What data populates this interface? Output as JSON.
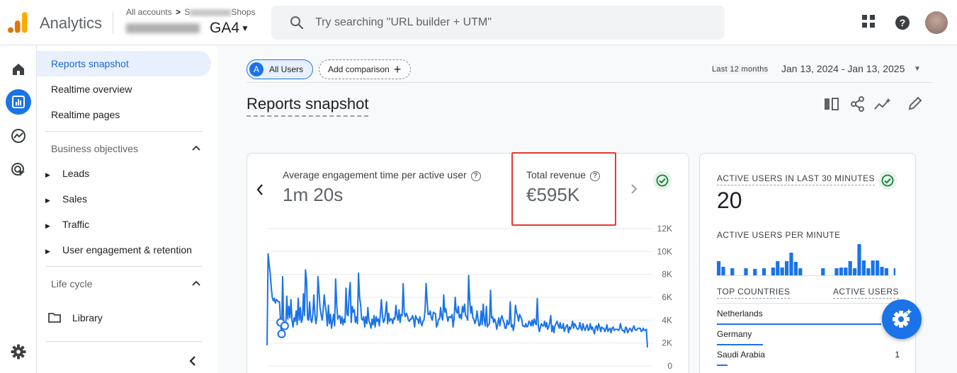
{
  "header": {
    "app_name": "Analytics",
    "breadcrumb_prefix": "All accounts",
    "breadcrumb_separator": ">",
    "breadcrumb_account_partial": "S",
    "breadcrumb_account_suffix": "Shops",
    "property_suffix": "GA4",
    "search_placeholder": "Try searching \"URL builder + UTM\""
  },
  "icons": {
    "apps": "apps-grid-icon",
    "help": "help-circle-icon",
    "home": "home-icon",
    "reports": "reports-icon",
    "explore": "explore-icon",
    "advertising": "advertising-icon",
    "settings": "settings-gear-icon"
  },
  "colors": {
    "accent": "#1a73e8",
    "highlight": "#e53935",
    "success": "#188038"
  },
  "sidenav": {
    "top_items": [
      {
        "label": "Reports snapshot",
        "active": true
      },
      {
        "label": "Realtime overview",
        "active": false
      },
      {
        "label": "Realtime pages",
        "active": false
      }
    ],
    "business_objectives": {
      "title": "Business objectives",
      "items": [
        "Leads",
        "Sales",
        "Traffic",
        "User engagement & retention"
      ]
    },
    "life_cycle": {
      "title": "Life cycle"
    },
    "library": "Library"
  },
  "toolbar": {
    "segment_badge": "A",
    "segment_label": "All Users",
    "add_comparison": "Add comparison",
    "date_preset": "Last 12 months",
    "date_range": "Jan 13, 2024 - Jan 13, 2025"
  },
  "page": {
    "title": "Reports snapshot"
  },
  "metrics": {
    "engagement": {
      "label": "Average engagement time per active user",
      "value": "1m 20s"
    },
    "revenue": {
      "label": "Total revenue",
      "value": "€595K"
    }
  },
  "chart_data": {
    "type": "line",
    "title": "",
    "xlabel": "",
    "ylabel": "",
    "ylim": [
      0,
      12000
    ],
    "y_ticks": [
      "12K",
      "10K",
      "8K",
      "6K",
      "4K",
      "2K",
      "0"
    ],
    "y_tick_values": [
      12000,
      10000,
      8000,
      6000,
      4000,
      2000,
      0
    ],
    "grid": true,
    "series": [
      {
        "values": [
          1800,
          9800,
          8900,
          8100,
          6900,
          6000,
          5700,
          5900,
          5500,
          5800,
          5700,
          5600,
          5600,
          3800,
          2800,
          7800,
          3500,
          3500,
          3600,
          6100,
          4100,
          5200,
          4200,
          5800,
          4000,
          3400,
          4200,
          3900,
          4800,
          3600,
          5900,
          4000,
          5100,
          3800,
          4100,
          6300,
          4400,
          8400,
          7400,
          4100,
          4000,
          5600,
          4100,
          3800,
          4500,
          6200,
          4500,
          3700,
          4300,
          7800,
          6400,
          5100,
          4500,
          4000,
          4900,
          6200,
          5300,
          4600,
          3500,
          5300,
          3700,
          4500,
          3300,
          3900,
          4500,
          3500,
          7600,
          5400,
          4100,
          4300,
          4400,
          3700,
          4300,
          3600,
          4100,
          3800,
          6800,
          4500,
          4400,
          6300,
          7300,
          3800,
          5200,
          4700,
          4900,
          3800,
          4300,
          3700,
          8100,
          6000,
          5400,
          4100,
          4000,
          4300,
          3400,
          4300,
          3700,
          5100,
          3900,
          3700,
          3300,
          4100,
          3600,
          4400,
          3400,
          4300,
          3900,
          4100,
          3500,
          4500,
          5800,
          4400,
          3800,
          4000,
          4700,
          5600,
          3700,
          4600,
          3900,
          4100,
          4100,
          3700,
          4200,
          4100,
          5300,
          4400,
          4000,
          4900,
          3800,
          4500,
          4400,
          7200,
          4600,
          4300,
          4600,
          4400,
          4000,
          3900,
          4100,
          4100,
          4400,
          4100,
          3400,
          4400,
          4100,
          4100,
          3700,
          4300,
          3800,
          3500,
          3900,
          4000,
          4800,
          7200,
          5600,
          4500,
          4500,
          4800,
          4200,
          4000,
          4700,
          4600,
          4600,
          3400,
          3600,
          4100,
          4100,
          5100,
          4300,
          4000,
          6200,
          4700,
          5000,
          4400,
          3900,
          4300,
          4300,
          4200,
          4500,
          3400,
          4200,
          6000,
          4800,
          4600,
          5200,
          4200,
          4500,
          4100,
          5200,
          4700,
          5400,
          4400,
          4300,
          4000,
          7900,
          5700,
          4600,
          5200,
          4200,
          4100,
          3700,
          4000,
          4800,
          4100,
          3500,
          3600,
          4800,
          3600,
          5400,
          4000,
          3500,
          5200,
          3400,
          3600,
          3700,
          6600,
          4200,
          4300,
          3800,
          4100,
          3800,
          3200,
          3700,
          4200,
          3500,
          4100,
          4400,
          4000,
          3800,
          3300,
          3300,
          4000,
          3600,
          3700,
          5600,
          3400,
          3600,
          3100,
          3700,
          5300,
          4700,
          4400,
          3900,
          4500,
          4300,
          4100,
          3500,
          3500,
          3400,
          3700,
          3400,
          3500,
          3900,
          3800,
          3500,
          4000,
          3500,
          4100,
          3800,
          3600,
          5900,
          3500,
          3000,
          3400,
          3700,
          3500,
          3500,
          3900,
          3400,
          3800,
          3200,
          3400,
          3800,
          4400,
          3000,
          3500,
          2900,
          3500,
          3700,
          3900,
          3600,
          3300,
          3800,
          3300,
          3300,
          3700,
          3000,
          3300,
          3500,
          3600,
          2900,
          3400,
          3200,
          3500,
          3900,
          3300,
          3700,
          3500,
          3300,
          3200,
          3300,
          3800,
          3300,
          3100,
          3700,
          3300,
          3100,
          3400,
          3600,
          3100,
          3200,
          3700,
          3200,
          3400,
          3100,
          2800,
          3400,
          3500,
          3100,
          3700,
          3400,
          3000,
          3400,
          3300,
          3300,
          3000,
          3200,
          3600,
          3000,
          3200,
          3300,
          2900,
          3300,
          3400,
          3100,
          3200,
          3200,
          3200,
          3100,
          3200,
          3700,
          3300,
          3100,
          3100,
          2900,
          3400,
          3300,
          2900,
          3100,
          3300,
          3200,
          3000,
          3300,
          3500,
          3200,
          3100,
          3200,
          3300,
          3300,
          3300,
          3000,
          3100,
          3300,
          3100,
          3100,
          3200,
          1600
        ]
      }
    ],
    "markers": [
      13,
      14,
      17
    ]
  },
  "realtime": {
    "active_label": "ACTIVE USERS IN LAST 30 MINUTES",
    "active_value": "20",
    "per_minute_label": "ACTIVE USERS PER MINUTE",
    "per_minute_values": [
      0,
      0,
      0,
      0,
      0,
      0,
      0,
      0,
      0,
      0,
      0,
      0,
      0,
      0,
      0,
      0,
      0,
      0,
      1,
      0,
      1,
      1,
      1,
      1,
      0,
      2,
      1,
      1,
      2,
      0,
      1,
      1,
      1,
      1,
      3,
      2,
      1,
      0,
      0,
      0,
      0,
      0,
      0,
      0,
      0,
      0,
      0,
      0,
      0,
      0,
      0,
      0,
      0,
      0,
      0,
      0,
      0,
      0,
      0,
      0,
      0,
      0,
      0,
      0,
      0,
      0,
      0,
      0,
      0,
      0,
      0,
      0,
      0,
      0,
      0,
      0,
      0,
      0,
      0,
      0,
      0,
      0,
      0,
      0,
      0,
      0,
      0,
      0,
      0,
      0,
      0,
      0,
      0,
      0,
      0,
      0,
      0,
      0,
      0,
      0,
      0,
      0,
      0,
      0,
      0,
      0,
      0,
      0,
      0,
      0,
      0,
      0,
      0,
      0,
      0,
      0,
      0,
      0,
      0,
      0,
      0,
      0,
      0,
      0,
      0,
      0,
      0,
      0,
      0,
      0,
      0,
      0,
      0,
      0,
      0,
      0,
      0,
      0,
      0,
      0,
      0,
      0,
      0,
      0,
      0,
      0,
      0,
      0,
      0,
      0,
      0,
      0,
      0,
      0,
      0,
      0,
      0,
      0,
      0,
      0,
      0,
      0,
      0,
      0,
      0,
      0,
      0,
      0,
      0,
      0,
      0,
      0,
      0,
      0,
      0,
      0,
      0,
      0,
      0,
      0,
      0,
      0,
      0,
      0,
      0,
      0,
      0,
      0,
      0,
      0,
      0,
      0,
      0,
      0,
      0,
      0,
      0,
      0,
      0,
      0,
      0,
      0,
      0,
      0,
      0,
      0,
      0,
      0,
      0,
      0,
      0,
      0,
      0,
      0,
      0,
      0,
      0,
      0,
      0,
      0,
      0,
      0,
      0,
      0,
      0,
      0,
      0,
      0,
      0,
      0,
      0,
      0,
      0,
      0,
      0,
      0,
      0,
      0,
      0,
      0,
      0,
      0,
      0,
      0,
      0,
      0,
      0,
      0,
      0,
      0,
      0,
      0,
      0,
      0,
      0,
      0,
      0,
      0,
      0,
      0,
      0,
      0,
      0,
      0,
      0,
      0,
      0,
      0,
      0,
      0,
      0,
      0,
      0,
      0,
      0,
      0,
      0,
      0,
      0,
      0,
      0,
      0,
      0,
      0,
      0,
      0,
      0,
      0,
      0,
      0,
      0,
      0,
      0,
      0,
      0,
      0,
      0,
      0,
      0,
      0,
      0,
      0,
      0,
      0,
      0,
      0,
      0,
      0,
      0,
      0,
      0,
      0,
      0,
      0,
      0,
      0,
      0,
      0,
      0,
      0,
      0,
      0,
      0,
      0,
      0,
      0,
      0,
      0,
      0,
      0,
      0,
      0,
      0,
      0,
      0,
      0,
      0,
      0,
      0,
      0,
      0,
      0,
      0,
      0,
      0,
      0,
      0,
      0,
      0,
      0,
      0,
      0,
      0,
      0,
      0,
      0,
      0,
      0,
      0,
      0,
      0,
      0,
      0,
      0,
      0,
      0,
      0,
      0,
      0,
      0,
      0,
      0,
      0,
      0,
      0,
      0,
      0,
      0,
      0,
      0,
      0,
      0,
      0,
      0,
      0,
      0,
      0
    ],
    "per_minute_bars": [
      2,
      1.2,
      0,
      1,
      0,
      0,
      1,
      0,
      0.9,
      0,
      1,
      0,
      1.1,
      2,
      1.1,
      2,
      3.2,
      1.9,
      1,
      0,
      0,
      0,
      0,
      1,
      0,
      0,
      1,
      1.1,
      1.1,
      2,
      1,
      4.4,
      2.1,
      1,
      2.1,
      2.1,
      1.2,
      1,
      0,
      1
    ],
    "top_countries_label": "TOP COUNTRIES",
    "active_users_label": "ACTIVE USERS",
    "countries": [
      {
        "name": "Netherlands",
        "value": "",
        "share": 0.9
      },
      {
        "name": "Germany",
        "value": "",
        "share": 0.25
      },
      {
        "name": "Saudi Arabia",
        "value": "1",
        "share": 0.06
      }
    ]
  }
}
